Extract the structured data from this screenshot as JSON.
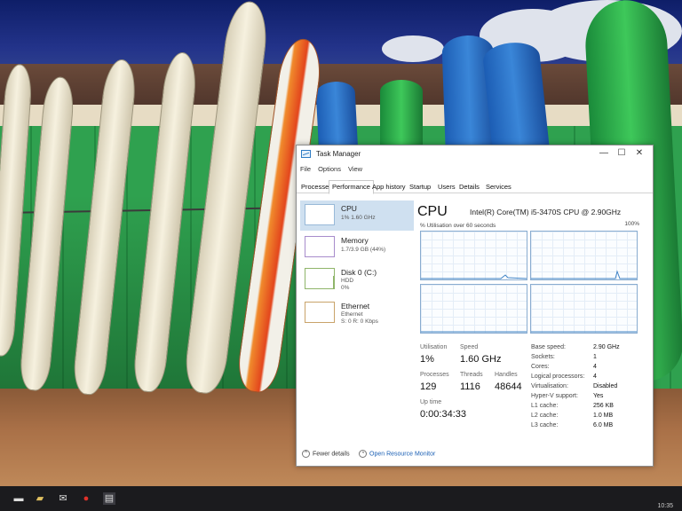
{
  "window": {
    "title": "Task Manager",
    "controls": {
      "minimize": "—",
      "maximize": "☐",
      "close": "✕"
    }
  },
  "menu": [
    "File",
    "Options",
    "View"
  ],
  "tabs": [
    "Processes",
    "Performance",
    "App history",
    "Startup",
    "Users",
    "Details",
    "Services"
  ],
  "active_tab": "Performance",
  "sidebar": {
    "items": [
      {
        "name": "CPU",
        "sub": "1% 1.60 GHz",
        "active": true
      },
      {
        "name": "Memory",
        "sub": "1.7/3.9 GB (44%)"
      },
      {
        "name": "Disk 0 (C:)",
        "sub": "HDD",
        "sub2": "0%"
      },
      {
        "name": "Ethernet",
        "sub": "Ethernet",
        "sub2": "S: 0 R: 0 Kbps"
      }
    ]
  },
  "cpu": {
    "heading": "CPU",
    "model": "Intel(R) Core(TM) i5-3470S CPU @ 2.90GHz",
    "graph_label": "% Utilisation over 60 seconds",
    "graph_max": "100%",
    "stats": {
      "utilisation_label": "Utilisation",
      "utilisation": "1%",
      "speed_label": "Speed",
      "speed": "1.60 GHz",
      "processes_label": "Processes",
      "processes": "129",
      "threads_label": "Threads",
      "threads": "1116",
      "handles_label": "Handles",
      "handles": "48644",
      "uptime_label": "Up time",
      "uptime": "0:00:34:33"
    },
    "specs": [
      {
        "k": "Base speed:",
        "v": "2.90 GHz"
      },
      {
        "k": "Sockets:",
        "v": "1"
      },
      {
        "k": "Cores:",
        "v": "4"
      },
      {
        "k": "Logical processors:",
        "v": "4"
      },
      {
        "k": "Virtualisation:",
        "v": "Disabled"
      },
      {
        "k": "Hyper-V support:",
        "v": "Yes"
      },
      {
        "k": "L1 cache:",
        "v": "256 KB"
      },
      {
        "k": "L2 cache:",
        "v": "1.0 MB"
      },
      {
        "k": "L3 cache:",
        "v": "6.0 MB"
      }
    ]
  },
  "footer": {
    "fewer_details": "Fewer details",
    "open_resource_monitor": "Open Resource Monitor"
  },
  "taskbar": {
    "clock": "10:35"
  },
  "colors": {
    "cpu_accent": "#89acd0",
    "link": "#1a5fb4",
    "selected_item": "#cfe0f0"
  }
}
